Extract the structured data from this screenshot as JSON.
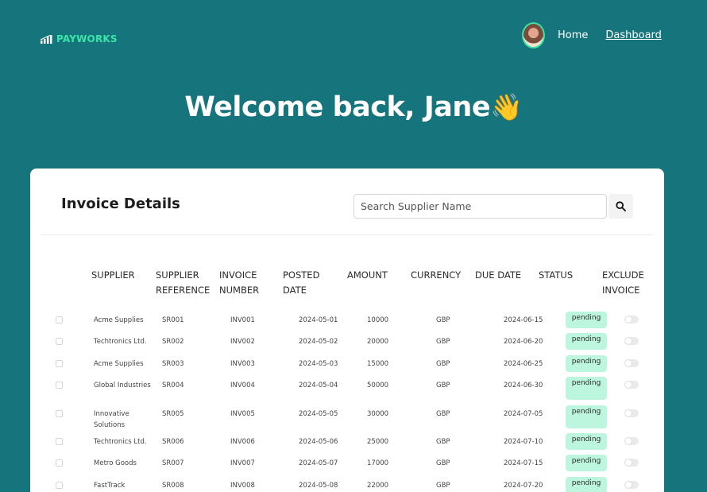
{
  "brand": {
    "name": "PAYWORKS"
  },
  "nav": {
    "home": "Home",
    "dashboard": "Dashboard"
  },
  "welcome": {
    "text": "Welcome back, Jane",
    "emoji": "👋"
  },
  "invoices": {
    "title": "Invoice Details",
    "search_placeholder": "Search Supplier Name",
    "columns": {
      "supplier": "SUPPLIER",
      "supplier_reference": "SUPPLIER REFERENCE",
      "invoice_number": "INVOICE NUMBER",
      "posted_date": "POSTED DATE",
      "amount": "AMOUNT",
      "currency": "CURRENCY",
      "due_date": "DUE DATE",
      "status": "STATUS",
      "exclude_invoice": "EXCLUDE INVOICE"
    },
    "rows": [
      {
        "supplier": "Acme Supplies",
        "ref": "SR001",
        "invoice": "INV001",
        "posted": "2024-05-01",
        "amount": "10000",
        "currency": "GBP",
        "due": "2024-06-15",
        "status": "pending"
      },
      {
        "supplier": "Techtronics Ltd.",
        "ref": "SR002",
        "invoice": "INV002",
        "posted": "2024-05-02",
        "amount": "20000",
        "currency": "GBP",
        "due": "2024-06-20",
        "status": "pending"
      },
      {
        "supplier": "Acme Supplies",
        "ref": "SR003",
        "invoice": "INV003",
        "posted": "2024-05-03",
        "amount": "15000",
        "currency": "GBP",
        "due": "2024-06-25",
        "status": "pending"
      },
      {
        "supplier": "Global Industries",
        "ref": "SR004",
        "invoice": "INV004",
        "posted": "2024-05-04",
        "amount": "50000",
        "currency": "GBP",
        "due": "2024-06-30",
        "status": "pending"
      },
      {
        "supplier": "Innovative Solutions",
        "ref": "SR005",
        "invoice": "INV005",
        "posted": "2024-05-05",
        "amount": "30000",
        "currency": "GBP",
        "due": "2024-07-05",
        "status": "pending"
      },
      {
        "supplier": "Techtronics Ltd.",
        "ref": "SR006",
        "invoice": "INV006",
        "posted": "2024-05-06",
        "amount": "25000",
        "currency": "GBP",
        "due": "2024-07-10",
        "status": "pending"
      },
      {
        "supplier": "Metro Goods",
        "ref": "SR007",
        "invoice": "INV007",
        "posted": "2024-05-07",
        "amount": "17000",
        "currency": "GBP",
        "due": "2024-07-15",
        "status": "pending"
      },
      {
        "supplier": "FastTrack",
        "ref": "SR008",
        "invoice": "INV008",
        "posted": "2024-05-08",
        "amount": "22000",
        "currency": "GBP",
        "due": "2024-07-20",
        "status": "pending"
      }
    ]
  },
  "colors": {
    "background": "#16757c",
    "brand": "#39e6a6",
    "badge": "#bdf6de"
  },
  "icons": {
    "logo": "signal-bars-icon",
    "search": "search-icon",
    "wave": "waving-hand-emoji"
  }
}
